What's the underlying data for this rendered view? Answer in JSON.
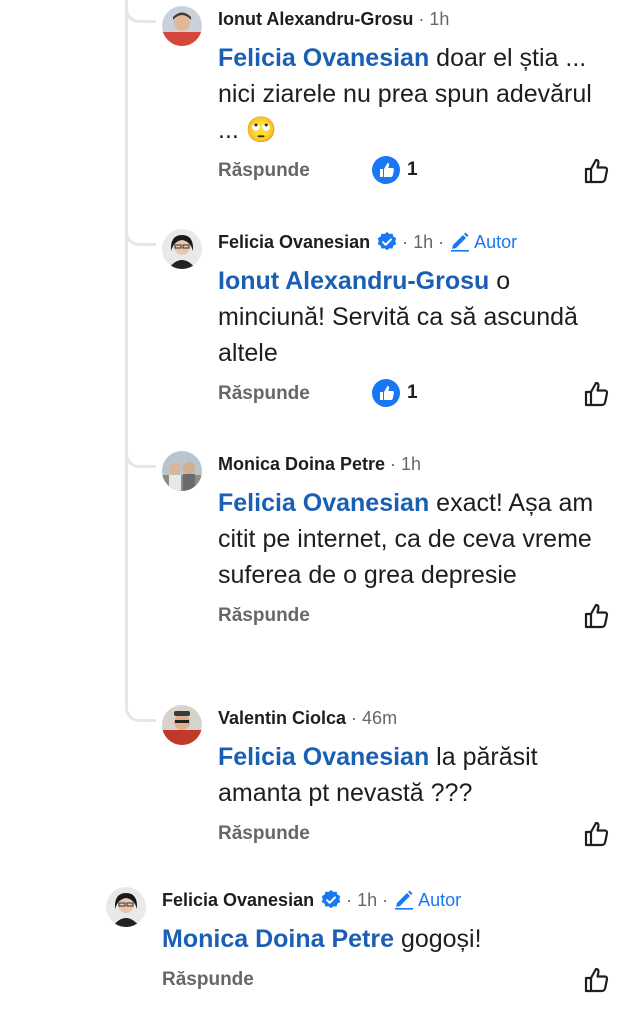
{
  "comments": [
    {
      "author": "Ionut Alexandru-Grosu",
      "time": "1h",
      "verified": false,
      "author_tag": "",
      "mention": "Felicia Ovanesian",
      "text": " doar el știa  ... nici ziarele nu prea spun adevărul ... 🙄",
      "reply_label": "Răspunde",
      "reaction_count": "1",
      "avatar_icon": "profile-photo"
    },
    {
      "author": "Felicia Ovanesian",
      "time": "1h",
      "verified": true,
      "author_tag": "Autor",
      "mention": "Ionut Alexandru-Grosu",
      "text": " o minciună! Servită ca să ascundă altele",
      "reply_label": "Răspunde",
      "reaction_count": "1",
      "avatar_icon": "profile-photo"
    },
    {
      "author": "Monica Doina Petre",
      "time": "1h",
      "verified": false,
      "author_tag": "",
      "mention": "Felicia Ovanesian",
      "text": " exact! Așa am citit pe internet, ca de ceva vreme suferea de o grea depresie",
      "reply_label": "Răspunde",
      "reaction_count": "",
      "avatar_icon": "profile-photo"
    },
    {
      "author": "Valentin Ciolca",
      "time": "46m",
      "verified": false,
      "author_tag": "",
      "mention": "Felicia Ovanesian",
      "text": " la părăsit amanta pt nevastă ???",
      "reply_label": "Răspunde",
      "reaction_count": "",
      "avatar_icon": "profile-photo"
    },
    {
      "author": "Felicia Ovanesian",
      "time": "1h",
      "verified": true,
      "author_tag": "Autor",
      "mention": "Monica Doina Petre",
      "text": " gogoși!",
      "reply_label": "Răspunde",
      "reaction_count": "",
      "avatar_icon": "profile-photo"
    }
  ],
  "colors": {
    "mention": "#1a5fb4",
    "accent": "#1877f2",
    "muted": "#65676b",
    "thread_line": "#e4e6ea"
  },
  "icons": {
    "verified": "verified-badge-icon",
    "author_tag": "pencil-icon",
    "reaction": "like-reaction-icon",
    "like_button": "thumbs-up-outline-icon"
  }
}
